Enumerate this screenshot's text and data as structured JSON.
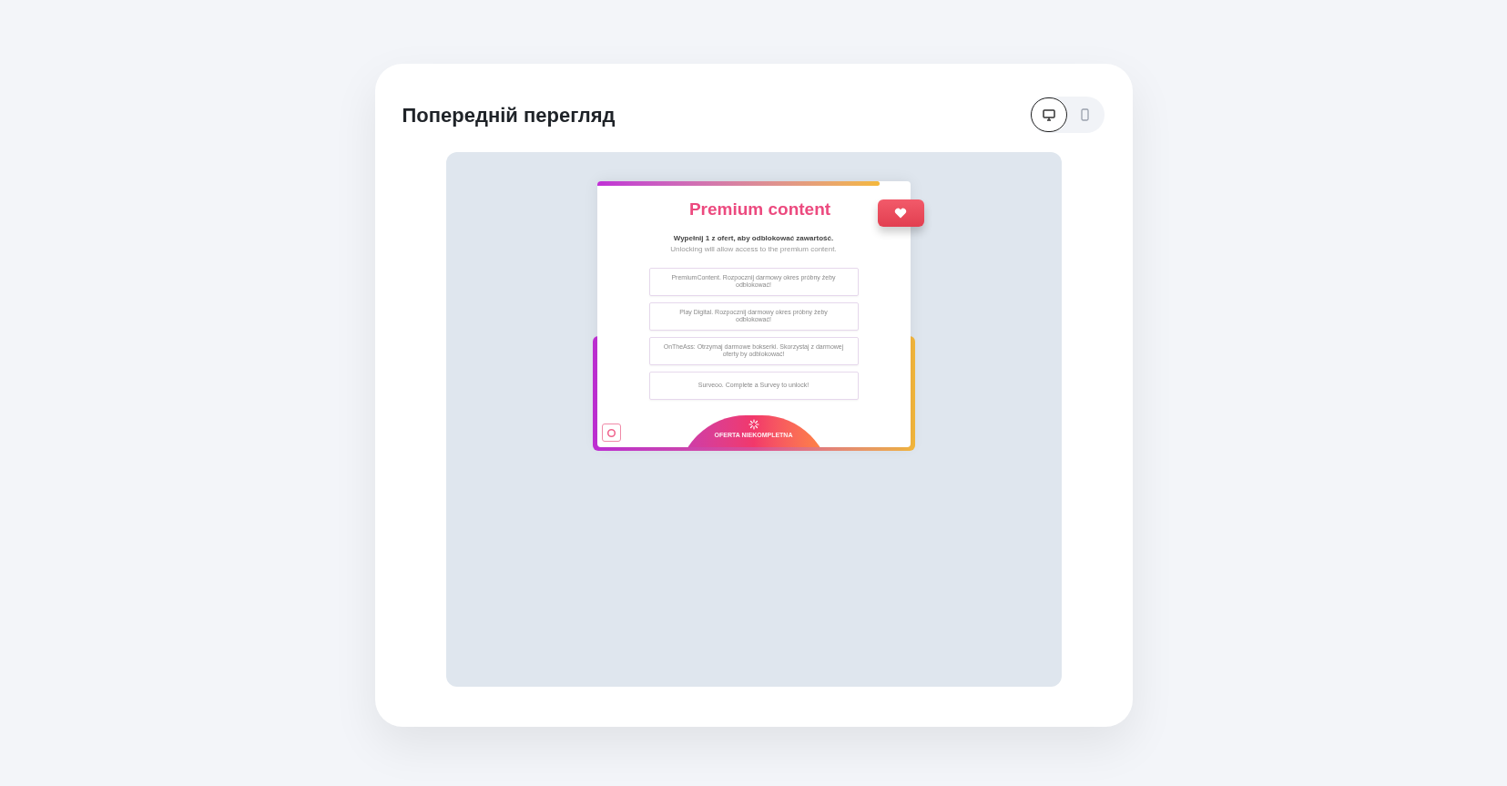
{
  "panel": {
    "title": "Попередній перегляд"
  },
  "view_toggle": [
    {
      "kind": "desktop",
      "selected": true
    },
    {
      "kind": "mobile",
      "selected": false
    }
  ],
  "preview": {
    "title": "Premium content",
    "instruction": "Wypełnij 1 z ofert, aby odblokować zawartość.",
    "subtitle": "Unlocking will allow access to the premium content.",
    "offers": [
      "PremiumContent. Rozpocznij darmowy okres próbny żeby odblokować!",
      "Play Digital. Rozpocznij darmowy okres próbny żeby odblokować!",
      "OnTheAss: Otrzymaj darmowe bokserki. Skorzystaj z darmowej oferty by odblokować!",
      "Surveoo. Complete a Survey to unlock!"
    ],
    "status_label": "OFERTA NIEKOMPLETNA"
  }
}
